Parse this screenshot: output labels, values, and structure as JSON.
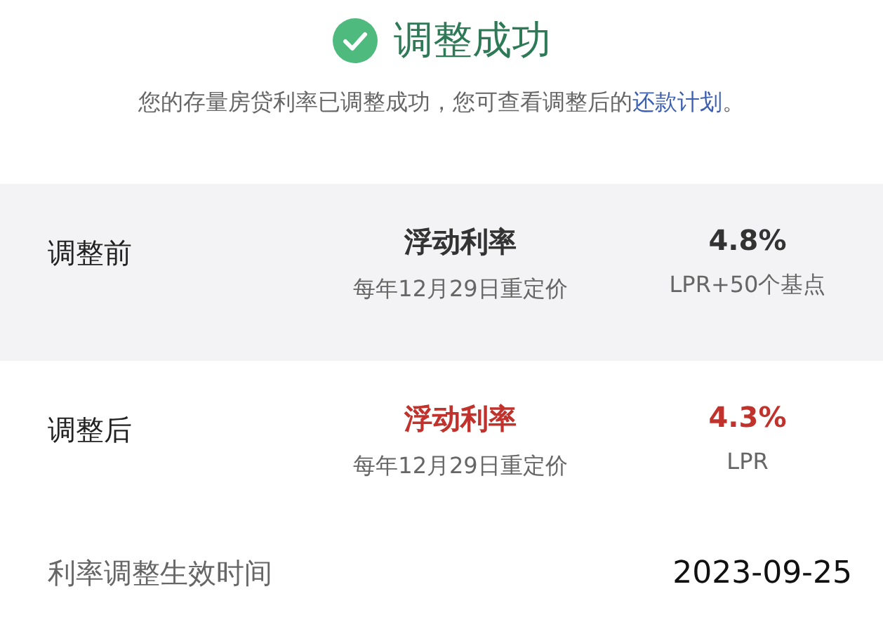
{
  "header": {
    "title": "调整成功",
    "message": "您的存量房贷利率已调整成功，您可查看调整后的",
    "link": "还款计划",
    "message_end": "。"
  },
  "rows": [
    {
      "label": "调整前",
      "rate_type": "浮动利率",
      "reprice": "每年12月29日重定价",
      "rate": "4.8%",
      "basis": "LPR+50个基点",
      "highlighted": false,
      "shaded": true
    },
    {
      "label": "调整后",
      "rate_type": "浮动利率",
      "reprice": "每年12月29日重定价",
      "rate": "4.3%",
      "basis": "LPR",
      "highlighted": true,
      "shaded": false
    }
  ],
  "effective": {
    "label": "利率调整生效时间",
    "value": "2023-09-25"
  }
}
